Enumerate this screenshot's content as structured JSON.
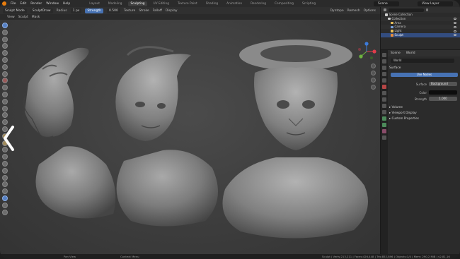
{
  "topbar": {
    "menus": [
      "File",
      "Edit",
      "Render",
      "Window",
      "Help"
    ],
    "workspaces": [
      "Layout",
      "Modeling",
      "Sculpting",
      "UV Editing",
      "Texture Paint",
      "Shading",
      "Animation",
      "Rendering",
      "Compositing",
      "Scripting"
    ],
    "active_workspace": "Sculpting",
    "scene": "Scene",
    "view_layer": "View Layer"
  },
  "header": {
    "brush_name": "SculptDraw",
    "radius_label": "Radius",
    "radius_value": "1 px",
    "strength_label": "Strength",
    "strength_value": "0.500",
    "view_label": "View",
    "sculpt_label": "Sculpt",
    "mask_label": "Mask",
    "dyntopo_label": "Dyntopo",
    "remesh_label": "Remesh",
    "options_label": "Options",
    "texture_label": "Texture",
    "stroke_label": "Stroke",
    "falloff_label": "Falloff",
    "display_label": "Display",
    "mode": "Sculpt Mode"
  },
  "outliner": {
    "title": "Scene Collection",
    "rows": [
      {
        "label": "Scene Collection",
        "icon_color": "#cfcfcf"
      },
      {
        "label": "Collection",
        "icon_color": "#cfcfcf"
      },
      {
        "label": "Area",
        "icon_color": "#e8c05b"
      },
      {
        "label": "Camera",
        "icon_color": "#7ea6e0"
      },
      {
        "label": "Light",
        "icon_color": "#e8c05b"
      },
      {
        "label": "Sculpt",
        "icon_color": "#e88d3a"
      }
    ]
  },
  "properties": {
    "tabs": [
      "Scene",
      "World"
    ],
    "world_name": "World",
    "surface_title": "Surface",
    "use_nodes_label": "Use Nodes",
    "surface_label": "Surface",
    "surface_value": "Background",
    "color_label": "Color",
    "strength_label": "Strength",
    "strength_value": "1.000",
    "sections": [
      "Volume",
      "Viewport Display",
      "Custom Properties"
    ]
  },
  "status": {
    "left": "Pan View",
    "mid": "Context Menu",
    "right": "Sculpt | Verts:213,211 | Faces:426,448 | Tris:852,896 | Objects:1/4 | Mem: 290.2 MiB | v2.81.16"
  },
  "colors": {
    "accent_blue": "#4772b3",
    "gizmo_x": "#e03c4b",
    "gizmo_y": "#6db33f",
    "gizmo_z": "#3d7bd9"
  }
}
